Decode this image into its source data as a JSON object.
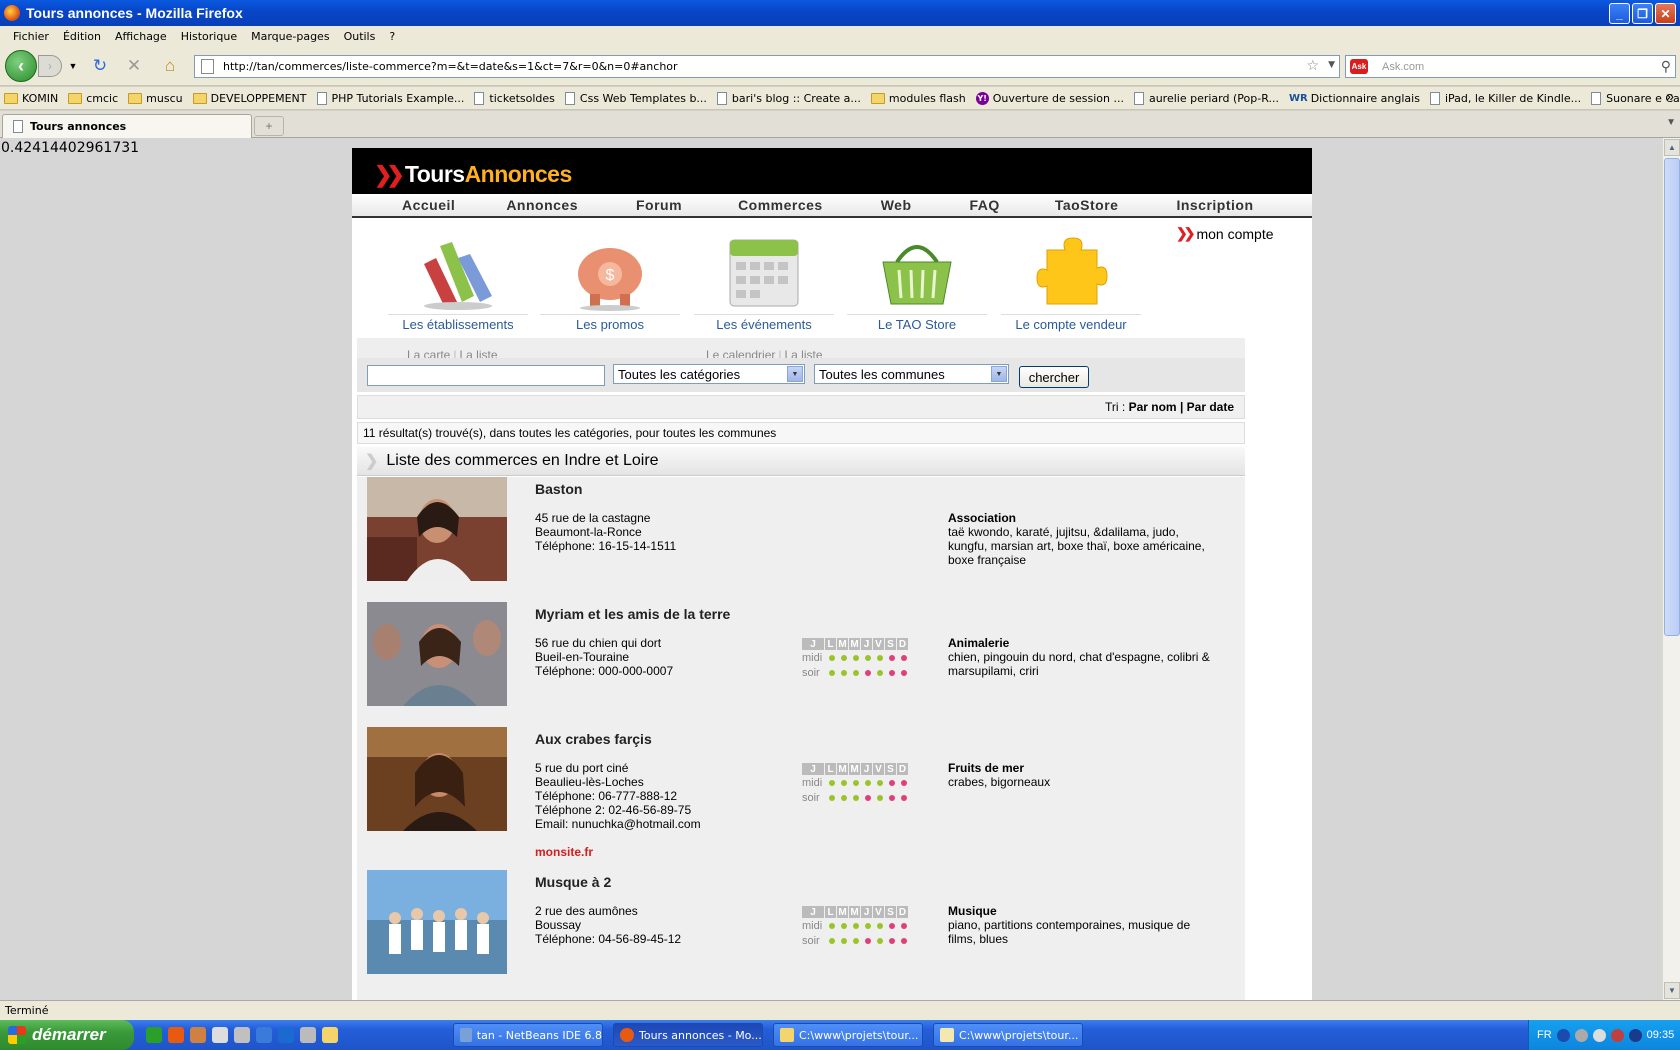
{
  "window": {
    "title": "Tours annonces - Mozilla Firefox"
  },
  "menu": [
    "Fichier",
    "Édition",
    "Affichage",
    "Historique",
    "Marque-pages",
    "Outils",
    "?"
  ],
  "url": "http://tan/commerces/liste-commerce?m=&t=date&s=1&ct=7&r=0&n=0#anchor",
  "search": {
    "placeholder": "Ask.com"
  },
  "bookmarks": [
    {
      "label": "KOMIN",
      "icon": "folder-icon"
    },
    {
      "label": "cmcic",
      "icon": "folder-icon"
    },
    {
      "label": "muscu",
      "icon": "folder-icon"
    },
    {
      "label": "DEVELOPPEMENT",
      "icon": "folder-icon"
    },
    {
      "label": "PHP Tutorials Example...",
      "icon": "page-icon"
    },
    {
      "label": "ticketsoldes",
      "icon": "page-icon"
    },
    {
      "label": "Css Web Templates b...",
      "icon": "page-icon"
    },
    {
      "label": "bari's blog :: Create a...",
      "icon": "page-icon"
    },
    {
      "label": "modules flash",
      "icon": "folder-icon"
    },
    {
      "label": "Ouverture de session ...",
      "icon": "yahoo-icon"
    },
    {
      "label": "aurelie periard (Pop-R...",
      "icon": "page-icon"
    },
    {
      "label": "Dictionnaire anglais",
      "icon": "wr-icon"
    },
    {
      "label": "iPad, le Killer de Kindle...",
      "icon": "page-icon"
    },
    {
      "label": "Suonare e Cantare su...",
      "icon": "page-icon"
    }
  ],
  "tab": {
    "label": "Tours annonces"
  },
  "debug_number": "0.42414402961731",
  "site": {
    "logo": {
      "part1": "Tours",
      "part2": "Annonces"
    },
    "nav": [
      "Accueil",
      "Annonces",
      "Forum",
      "Commerces",
      "Web",
      "FAQ",
      "TaoStore",
      "Inscription"
    ],
    "account": "mon compte",
    "features": [
      {
        "label": "Les établissements",
        "icon": "bar-chart-icon"
      },
      {
        "label": "Les promos",
        "icon": "piggy-bank-icon"
      },
      {
        "label": "Les événements",
        "icon": "calendar-icon"
      },
      {
        "label": "Le TAO Store",
        "icon": "shopping-basket-icon"
      },
      {
        "label": "Le compte vendeur",
        "icon": "puzzle-icon"
      }
    ],
    "sublinks_left": [
      "La carte",
      "La liste"
    ],
    "sublinks_right": [
      "Le calendrier",
      "La liste"
    ],
    "filters": {
      "query": "",
      "category": "Toutes les catégories",
      "commune": "Toutes les communes",
      "button": "chercher"
    },
    "sort": {
      "label": "Tri :",
      "by_name": "Par nom",
      "sep": "|",
      "by_date": "Par date"
    },
    "results_text": "11 résultat(s) trouvé(s), dans toutes les catégories, pour toutes les communes",
    "list_title": "Liste des commerces en Indre et Loire",
    "schedule_days": [
      "J",
      "L",
      "M",
      "M",
      "J",
      "V",
      "S",
      "D"
    ],
    "schedule_rows": [
      "midi",
      "soir"
    ],
    "items": [
      {
        "name": "Baston",
        "address": [
          "45 rue de la castagne",
          "Beaumont-la-Ronce",
          "Téléphone: 16-15-14-1511"
        ],
        "category": "Association",
        "tags": "taë kwondo, karaté, jujitsu, &dalilama, judo, kungfu, marsian art, boxe thaï, boxe américaine, boxe française",
        "has_schedule": false,
        "website": ""
      },
      {
        "name": "Myriam et les amis de la terre",
        "address": [
          "56 rue du chien qui dort",
          "Bueil-en-Touraine",
          "Téléphone: 000-000-0007"
        ],
        "category": "Animalerie",
        "tags": "chien, pingouin du nord, chat d'espagne, colibri & marsupilami, criri",
        "has_schedule": true,
        "website": ""
      },
      {
        "name": "Aux crabes farçis",
        "address": [
          "5 rue du port ciné",
          "Beaulieu-lès-Loches",
          "Téléphone: 06-777-888-12",
          "Téléphone 2: 02-46-56-89-75",
          "Email: nunuchka@hotmail.com"
        ],
        "category": "Fruits de mer",
        "tags": "crabes, bigorneaux",
        "has_schedule": true,
        "website": "monsite.fr"
      },
      {
        "name": "Musque à 2",
        "address": [
          "2 rue des aumônes",
          "Boussay",
          "Téléphone: 04-56-89-45-12"
        ],
        "category": "Musique",
        "tags": "piano, partitions contemporaines, musique de films, blues",
        "has_schedule": true,
        "website": ""
      }
    ]
  },
  "statusbar": "Terminé",
  "taskbar": {
    "start": "démarrer",
    "tasks": [
      {
        "label": "tan - NetBeans IDE 6.8",
        "active": false
      },
      {
        "label": "Tours annonces - Mo...",
        "active": true
      },
      {
        "label": "C:\\www\\projets\\tour...",
        "active": false
      },
      {
        "label": "C:\\www\\projets\\tour...",
        "active": false
      }
    ],
    "lang": "FR",
    "clock": "09:35"
  },
  "colors": {
    "xp_blue": "#0846c9",
    "brand_red": "#e02020",
    "brand_orange": "#ffb020",
    "link_blue": "#2a5a9a",
    "dot_green": "#9ac42a",
    "dot_pink": "#e0407a"
  }
}
